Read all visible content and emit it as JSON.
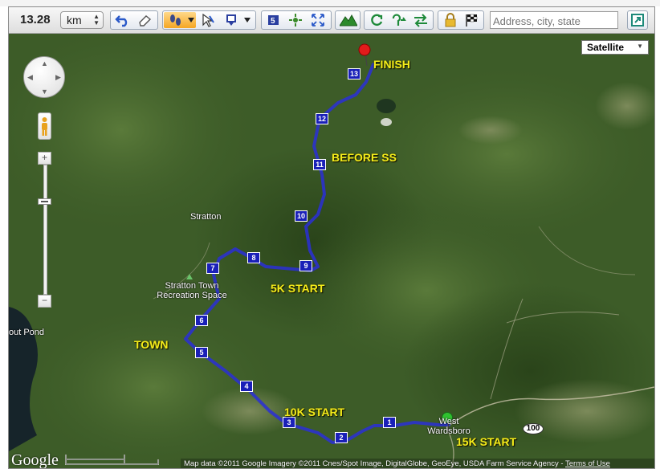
{
  "toolbar": {
    "distance": "13.28",
    "unit": "km",
    "search_placeholder": "Address, city, state",
    "icons": [
      "undo-icon",
      "eraser-icon",
      "footsteps-icon",
      "draw-cursor-icon",
      "marker-icon",
      "mile-marker-icon",
      "center-icon",
      "fullscreen-icon",
      "elevation-icon",
      "loop-icon",
      "out-and-back-icon",
      "reverse-icon",
      "lock-icon",
      "checkered-flag-icon",
      "go-icon"
    ]
  },
  "map": {
    "map_type": "Satellite",
    "route_labels": {
      "finish": "FINISH",
      "before_ss": "BEFORE SS",
      "five_k_start": "5K START",
      "town": "TOWN",
      "ten_k_start": "10K START",
      "fifteen_k_start": "15K START"
    },
    "places": {
      "stratton": "Stratton",
      "recreation_line1": "Stratton Town",
      "recreation_line2": "Recreation Space",
      "west_line1": "West",
      "west_line2": "Wardsboro",
      "pond": "out Pond"
    },
    "route_shield": "100",
    "km_markers": [
      "1",
      "2",
      "3",
      "4",
      "5",
      "6",
      "7",
      "8",
      "9",
      "10",
      "11",
      "12",
      "13"
    ],
    "google_logo": "Google",
    "attribution": "Map data ©2011 Google Imagery ©2011 Cnes/Spot Image, DigitalGlobe, GeoEye, USDA Farm Service Agency - ",
    "terms": "Terms of Use",
    "colors": {
      "route": "#2a2fd6",
      "label": "#f4ec1a",
      "marker": "#1a20b8"
    }
  }
}
